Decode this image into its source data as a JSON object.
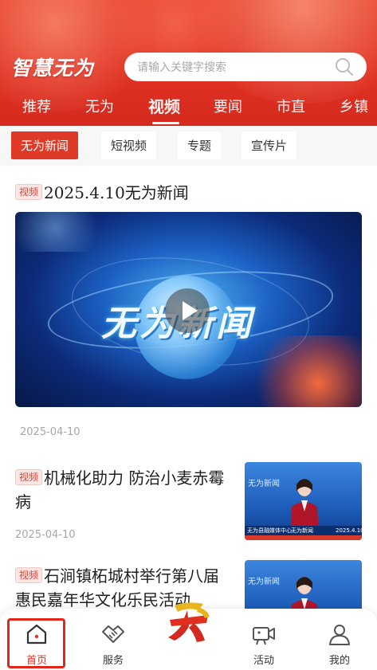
{
  "header": {
    "logo_text": "智慧无为",
    "search": {
      "placeholder": "请输入关键字搜索"
    },
    "nav": [
      {
        "label": "推荐"
      },
      {
        "label": "无为"
      },
      {
        "label": "视频",
        "active": true
      },
      {
        "label": "要闻"
      },
      {
        "label": "市直"
      },
      {
        "label": "乡镇"
      }
    ]
  },
  "subtabs": [
    {
      "label": "无为新闻",
      "active": true
    },
    {
      "label": "短视频"
    },
    {
      "label": "专题"
    },
    {
      "label": "宣传片"
    }
  ],
  "feed": [
    {
      "badge": "视频",
      "title": "2025.4.10无为新闻",
      "video_overlay_text": "无为新闻",
      "date": "2025-04-10"
    },
    {
      "badge": "视频",
      "title": "机械化助力 防治小麦赤霉病",
      "date": "2025-04-10",
      "thumb_texts": [
        "无为新闻",
        "无为县融媒体中心",
        "2025.4.10"
      ]
    },
    {
      "badge": "视频",
      "title": "石涧镇柘城村举行第八届惠民嘉年华文化乐民活动",
      "thumb_texts": [
        "无为新闻"
      ]
    }
  ],
  "tabbar": [
    {
      "label": "首页",
      "icon": "home-icon",
      "active": true
    },
    {
      "label": "服务",
      "icon": "handshake-icon"
    },
    {
      "label": "",
      "icon": "center-logo-icon"
    },
    {
      "label": "活动",
      "icon": "video-camera-icon"
    },
    {
      "label": "我的",
      "icon": "user-icon"
    }
  ],
  "colors": {
    "brand_red": "#df3a27",
    "badge_text": "#d8453a",
    "date_gray": "#a6a6a6"
  }
}
